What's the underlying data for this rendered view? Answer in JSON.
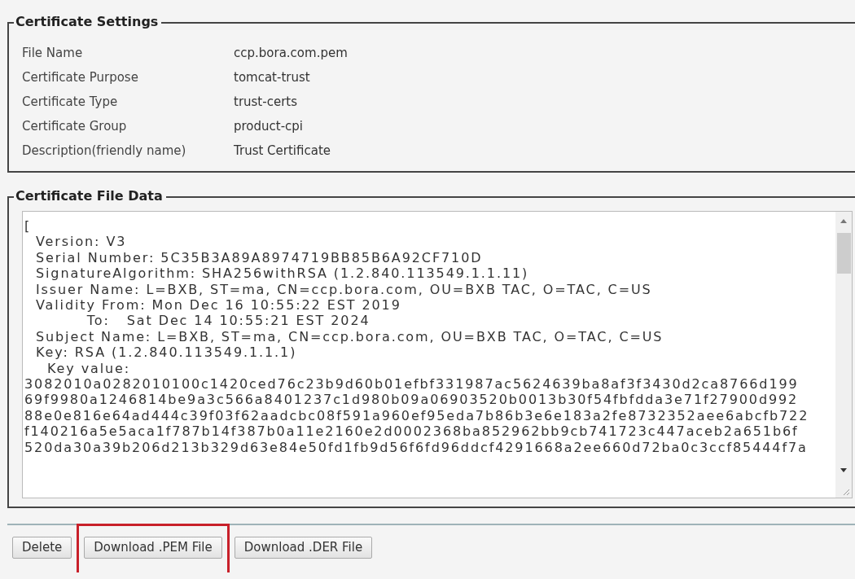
{
  "certificate_settings": {
    "legend": "Certificate Settings",
    "rows": [
      {
        "label": "File Name",
        "value": "ccp.bora.com.pem"
      },
      {
        "label": "Certificate Purpose",
        "value": "tomcat-trust"
      },
      {
        "label": "Certificate Type",
        "value": "trust-certs"
      },
      {
        "label": "Certificate Group",
        "value": "product-cpi"
      },
      {
        "label": "Description(friendly name)",
        "value": "Trust Certificate"
      }
    ]
  },
  "certificate_file_data": {
    "legend": "Certificate File Data",
    "lines": [
      "[",
      "  Version: V3",
      "  Serial Number: 5C35B3A89A8974719BB85B6A92CF710D",
      "  SignatureAlgorithm: SHA256withRSA (1.2.840.113549.1.1.11)",
      "  Issuer Name: L=BXB, ST=ma, CN=ccp.bora.com, OU=BXB TAC, O=TAC, C=US",
      "  Validity From: Mon Dec 16 10:55:22 EST 2019",
      "           To:   Sat Dec 14 10:55:21 EST 2024",
      "  Subject Name: L=BXB, ST=ma, CN=ccp.bora.com, OU=BXB TAC, O=TAC, C=US",
      "  Key: RSA (1.2.840.113549.1.1.1)",
      "    Key value:",
      "3082010a0282010100c1420ced76c23b9d60b01efbf331987ac5624639ba8af3f3430d2ca8766d199",
      "69f9980a1246814be9a3c566a8401237c1d980b09a06903520b0013b30f54fbfdda3e71f27900d992",
      "88e0e816e64ad444c39f03f62aadcbc08f591a960ef95eda7b86b3e6e183a2fe8732352aee6abcfb722",
      "f140216a5e5aca1f787b14f387b0a11e2160e2d0002368ba852962bb9cb741723c447aceb2a651b6f",
      "520da30a39b206d213b329d63e84e50fd1fb9d56f6fd96ddcf4291668a2ee660d72ba0c3ccf85444f7a"
    ]
  },
  "buttons": [
    {
      "label": "Delete",
      "highlighted": false
    },
    {
      "label": "Download .PEM File",
      "highlighted": true
    },
    {
      "label": "Download .DER File",
      "highlighted": false
    }
  ]
}
